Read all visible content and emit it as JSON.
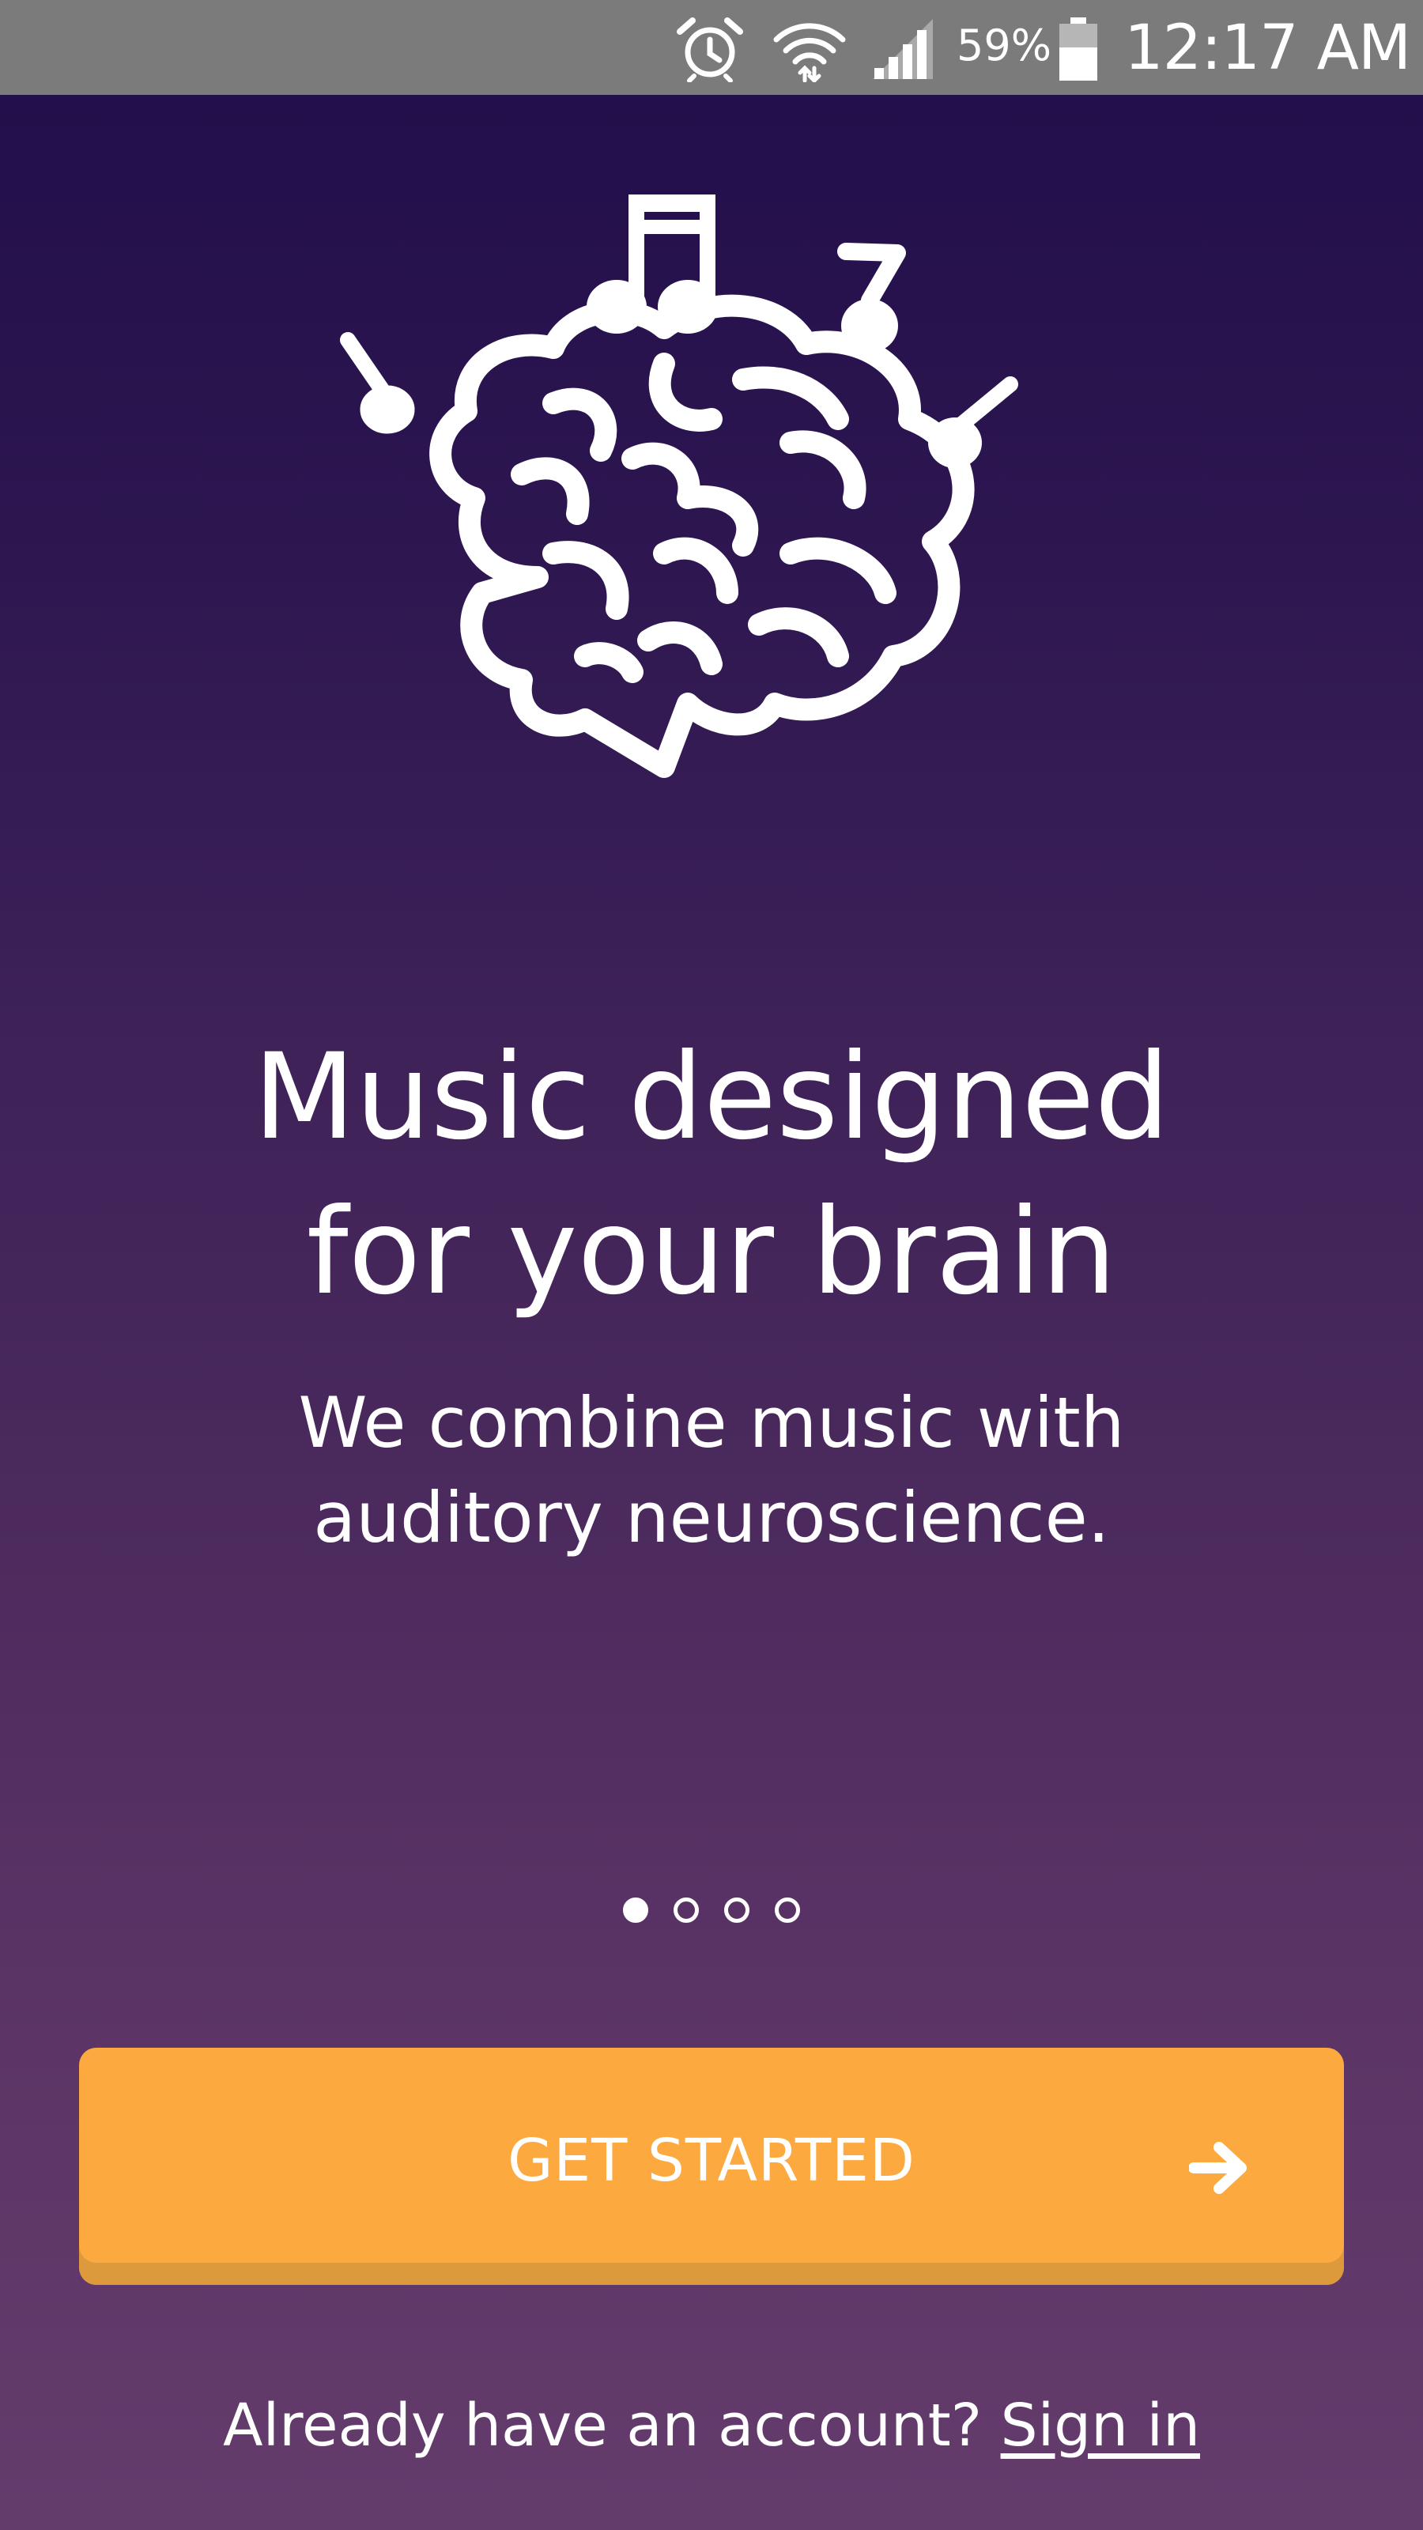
{
  "status_bar": {
    "icons": [
      "alarm-icon",
      "wifi-icon",
      "cell-signal-icon",
      "battery-icon"
    ],
    "battery_percent": "59%",
    "time": "12:17 AM"
  },
  "onboarding": {
    "illustration": "brain-with-music-notes",
    "headline": [
      "Music designed",
      "for your brain"
    ],
    "subline": [
      "We combine music with",
      "auditory neuroscience."
    ],
    "pager": {
      "total": 4,
      "active_index": 0
    },
    "cta_label": "GET STARTED",
    "cta_icon": "arrow-right-icon",
    "signin_prompt": "Already have an account?",
    "signin_link": "Sign in"
  },
  "colors": {
    "background_top": "#220f4b",
    "background_bottom": "#643c6c",
    "cta": "#fcaa40",
    "cta_shadow": "#dc9a3c",
    "status_bar": "#7b7b7b",
    "text": "#ffffff"
  }
}
